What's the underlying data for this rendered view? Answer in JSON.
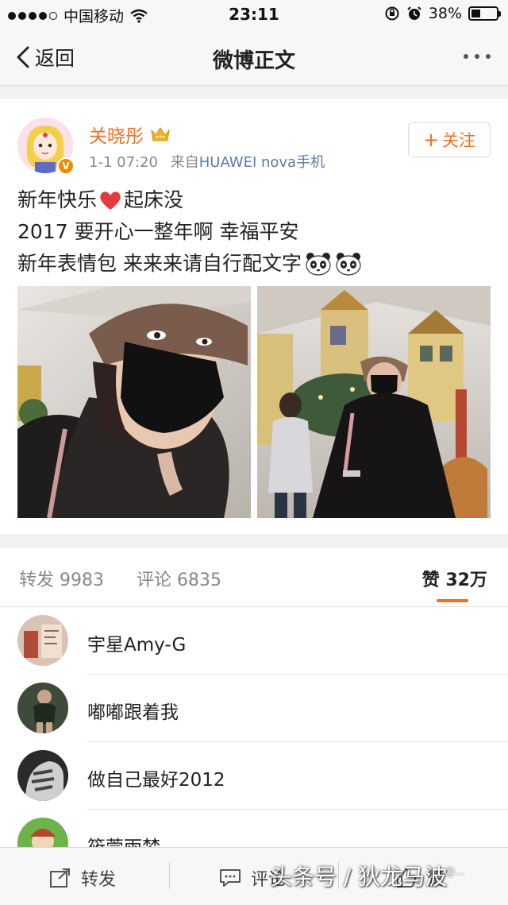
{
  "status_bar": {
    "carrier": "中国移动",
    "time": "23:11",
    "battery": "38%",
    "battery_level": 0.38
  },
  "nav": {
    "back_label": "返回",
    "title": "微博正文"
  },
  "post": {
    "author": "关晓彤",
    "timestamp": "1-1 07:20",
    "source_prefix": "来自",
    "source": "HUAWEI nova手机",
    "follow_label": "关注",
    "verified_badge": "V",
    "line1_a": "新年快乐",
    "line1_b": "起床没",
    "line2": "2017 要开心一整年啊 幸福平安",
    "line3": "新年表情包 来来来请自行配文字"
  },
  "stats": {
    "repost_label": "转发",
    "repost_count": "9983",
    "comment_label": "评论",
    "comment_count": "6835",
    "like_label": "赞",
    "like_count": "32万"
  },
  "likers": [
    {
      "name": "宇星Amy-G"
    },
    {
      "name": "嘟嘟跟着我"
    },
    {
      "name": "做自己最好2012"
    },
    {
      "name": "筱萱雨梦"
    }
  ],
  "toolbar": {
    "repost_label": "转发",
    "comment_label": "评论",
    "like_label": "赞"
  },
  "watermark": {
    "text": "头条号 / 狄龙马波",
    "small": "@..."
  },
  "colors": {
    "accent": "#f37021",
    "link": "#5b7ba9",
    "muted": "#888888"
  }
}
